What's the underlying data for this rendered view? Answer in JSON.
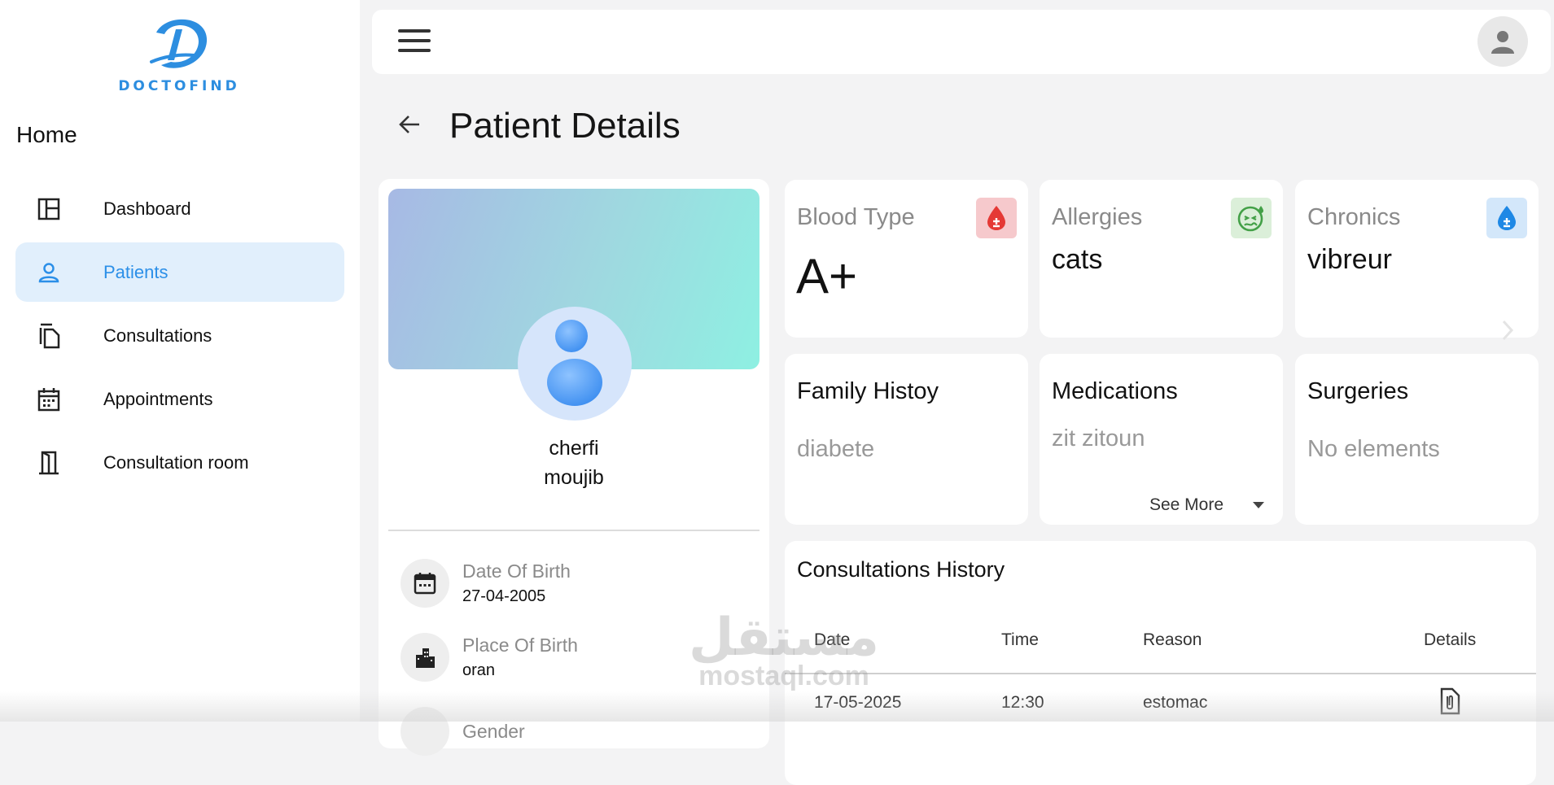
{
  "app": {
    "brand": "DOCTOFIND",
    "brand_color": "#2d8ee0"
  },
  "sidebar": {
    "section_title": "Home",
    "items": [
      {
        "label": "Dashboard",
        "icon": "dashboard-icon",
        "active": false
      },
      {
        "label": "Patients",
        "icon": "person-icon",
        "active": true
      },
      {
        "label": "Consultations",
        "icon": "documents-icon",
        "active": false
      },
      {
        "label": "Appointments",
        "icon": "calendar-icon",
        "active": false
      },
      {
        "label": "Consultation room",
        "icon": "door-icon",
        "active": false
      }
    ]
  },
  "header": {
    "menu_icon": "hamburger-menu-icon",
    "account_icon": "user-avatar-icon"
  },
  "page": {
    "title": "Patient Details",
    "back_icon": "arrow-left-icon"
  },
  "patient": {
    "first_name": "cherfi",
    "last_name": "moujib",
    "info": [
      {
        "label": "Date Of Birth",
        "value": "27-04-2005",
        "icon": "calendar-icon"
      },
      {
        "label": "Place Of Birth",
        "value": "oran",
        "icon": "city-icon"
      },
      {
        "label": "Gender",
        "value": "",
        "icon": "gender-icon"
      }
    ]
  },
  "stats": {
    "blood_type": {
      "title": "Blood Type",
      "value": "A+",
      "icon": "blood-drop-icon",
      "badge_color": "#f6c9cc",
      "icon_color": "#e53935"
    },
    "allergies": {
      "title": "Allergies",
      "value": "cats",
      "icon": "sick-face-icon",
      "badge_color": "#dbefd9",
      "icon_color": "#43a047"
    },
    "chronics": {
      "title": "Chronics",
      "value": "vibreur",
      "icon": "water-drop-icon",
      "badge_color": "#d3e7fa",
      "icon_color": "#1e88e5"
    },
    "family_history": {
      "title": "Family Histoy",
      "value": "diabete"
    },
    "medications": {
      "title": "Medications",
      "value": "zit zitoun",
      "see_more": "See More"
    },
    "surgeries": {
      "title": "Surgeries",
      "value": "No elements"
    }
  },
  "history": {
    "title": "Consultations History",
    "columns": [
      "Date",
      "Time",
      "Reason",
      "Details"
    ],
    "rows": [
      {
        "date": "17-05-2025",
        "time": "12:30",
        "reason": "estomac",
        "details_icon": "attachment-document-icon"
      }
    ]
  },
  "watermark": {
    "arabic": "مستقل",
    "latin": "mostaql.com"
  }
}
